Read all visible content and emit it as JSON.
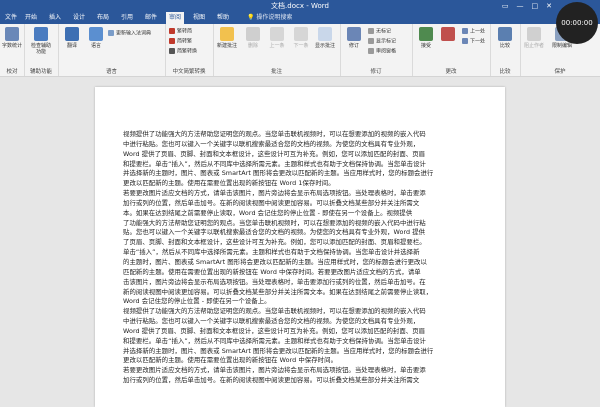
{
  "window": {
    "title": "文档.docx - Word",
    "recording_time": "00:00:00",
    "controls": [
      "▭",
      "—",
      "□",
      "✕"
    ]
  },
  "tabs": [
    "文件",
    "开始",
    "插入",
    "设计",
    "布局",
    "引用",
    "邮件",
    "审阅",
    "视图",
    "帮助"
  ],
  "active_tab": "审阅",
  "tell_me": "操作说明搜索",
  "ribbon": {
    "groups": [
      {
        "label": "校对"
      },
      {
        "label": "辅助功能"
      },
      {
        "label": "语言"
      },
      {
        "label": "中文简繁转换"
      },
      {
        "label": "批注"
      },
      {
        "label": "修订"
      },
      {
        "label": "更改"
      },
      {
        "label": "比较"
      },
      {
        "label": "保护"
      }
    ],
    "buttons": {
      "wordcount": "字数统计",
      "accessibility": "检查辅助功能",
      "translate": "翻译",
      "language": "语言",
      "update_ime": "更新输入法词典",
      "to_trad": "繁转简",
      "to_simp": "简转繁",
      "convert": "简繁转换",
      "new_comment": "新建批注",
      "delete": "删除",
      "prev": "上一条",
      "next": "下一条",
      "show_comments": "显示批注",
      "track": "修订",
      "markup_mode": "无标记",
      "show_markup": "显示标记",
      "review_pane": "审阅窗格",
      "accept": "接受",
      "reject": "",
      "prev_change": "上一处",
      "next_change": "下一处",
      "compare": "比较",
      "block_authors": "阻止作者",
      "restrict_editing": "限制编辑"
    }
  },
  "document": {
    "lines": [
      "视频提供了功能强大的方法帮助您证明您的观点。当您单击联机视频时，可以在想要添加的视频的嵌入代码",
      "中进行粘贴。您也可以键入一个关键字以联机搜索最适合您的文档的视频。为使您的文档具有专业外观，",
      "Word 提供了页眉、页脚、封面和文本框设计，这些设计可互为补充。例如，您可以添加匹配的封面、页眉",
      "和提要栏。单击“插入”，然后从不同库中选择所需元素。主题和样式也有助于文档保持协调。当您单击设计",
      "并选择新的主题时，图片、图表或 SmartArt 图形将会更改以匹配新的主题。当应用样式时，您的标题会进行",
      "更改以匹配新的主题。使用在需要位置出现的新按钮在 Word 1保存时间。",
      "若要更改图片适应文档的方式，请单击该图片，图片旁边将会显示布局选项按钮。当处理表格时，单击要添",
      "加行或列的位置，然后单击加号。在新的阅读视图中阅读更加容易。可以折叠文档某些部分并关注所需文",
      "本。如果在达到结尾之前需要停止读取，Word 会记住您的停止位置 - 即使在另一个设备上。视频提供",
      "了功能强大的方法帮助您证明您的观点。当您单击联机视频时，可以在想要添加的视频的嵌入代码中进行粘",
      "贴。您也可以键入一个关键字以联机搜索最适合您的文档的视频。为使您的文档具有专业外观，Word 提供",
      "了页眉、页脚、封面和文本框设计，这些设计可互为补充。例如，您可以添加匹配的封面、页眉和提要栏。",
      "单击“插入”，然后从不同库中选择所需元素。主题和样式也有助于文档保持协调。当您单击设计并选择新",
      "的主题时，图片、图表或 SmartArt 图形将会更改以匹配新的主题。当应用样式时，您的标题会进行更改以",
      "匹配新的主题。使用在需要位置出现的新按钮在 Word 中保存时间。若要更改图片适应文档的方式，请单",
      "击该图片，图片旁边将会显示布局选项按钮。当处理表格时，单击要添加行或列的位置，然后单击加号。在",
      "新的阅读视图中阅读更加容易。可以折叠文档某些部分并关注所需文本。如果在达到结尾之前需要停止读取，",
      "Word 会记住您的停止位置 - 即使在另一个设备上。",
      "视频提供了功能强大的方法帮助您证明您的观点。当您单击联机视频时，可以在想要添加的视频的嵌入代码",
      "中进行粘贴。您也可以键入一个关键字以联机搜索最适合您的文档的视频。为使您的文档具有专业外观，",
      "Word 提供了页眉、页脚、封面和文本框设计，这些设计可互为补充。例如，您可以添加匹配的封面、页眉",
      "和提要栏。单击“插入”，然后从不同库中选择所需元素。主题和样式也有助于文档保持协调。当您单击设计",
      "并选择新的主题时，图片、图表或 SmartArt 图形将会更改以匹配新的主题。当应用样式时，您的标题会进行",
      "更改以匹配新的主题。使用在需要位置出现的新按钮在 Word 中保存时间。",
      "若要更改图片适应文档的方式，请单击该图片，图片旁边将会显示布局选项按钮。当处理表格时，单击要添",
      "加行或列的位置，然后单击加号。在新的阅读视图中阅读更加容易。可以折叠文档某些部分并关注所需文"
    ]
  }
}
